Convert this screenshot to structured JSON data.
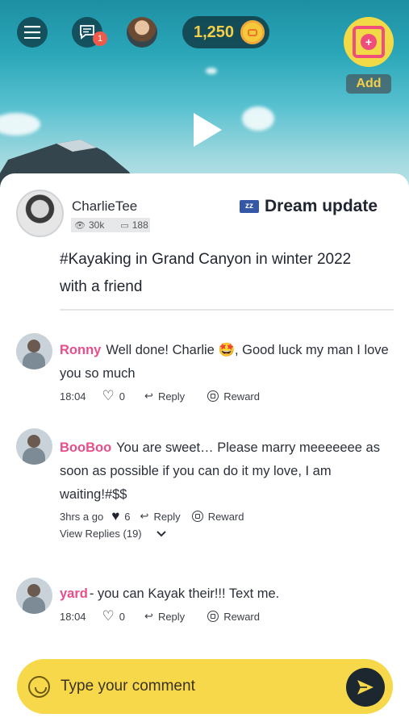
{
  "header": {
    "chat_badge": "1",
    "coins": "1,250",
    "add_label": "Add"
  },
  "post": {
    "author": "CharlieTee",
    "views": "30k",
    "comments_count": "188",
    "dream_label": "Dream update",
    "title": "#Kayaking in Grand Canyon in winter 2022 with a friend"
  },
  "comments": [
    {
      "user": "Ronny",
      "text": "Well done! Charlie 🤩, Good luck my man I love you so much",
      "time": "18:04",
      "likes": "0",
      "reply_label": "Reply",
      "reward_label": "Reward"
    },
    {
      "user": "BooBoo",
      "text": "You are sweet… Please marry meeeeeee as soon as possible if you can do it my love, I am waiting!#$$",
      "time": "3hrs a go",
      "likes": "6",
      "reply_label": "Reply",
      "reward_label": "Reward",
      "view_replies": "View Replies (19)"
    },
    {
      "user": "yard",
      "text": "- you can Kayak their!!! Text me.",
      "time": "18:04",
      "likes": "0",
      "reply_label": "Reply",
      "reward_label": "Reward"
    }
  ],
  "composer": {
    "placeholder": "Type your comment"
  },
  "colors": {
    "accent_yellow": "#f6d84a",
    "username_pink": "#e84e8a",
    "dark": "#1d2730"
  },
  "icons": [
    "menu-icon",
    "chat-icon",
    "coin-icon",
    "add-icon",
    "play-icon",
    "eye-icon",
    "comment-icon",
    "dream-icon",
    "heart-icon",
    "reply-icon",
    "reward-icon",
    "chevron-down-icon",
    "smile-icon",
    "send-icon"
  ]
}
